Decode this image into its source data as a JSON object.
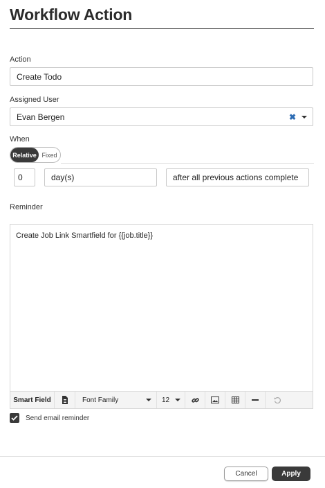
{
  "header": {
    "title": "Workflow Action"
  },
  "action": {
    "label": "Action",
    "value": "Create Todo"
  },
  "assigned_user": {
    "label": "Assigned User",
    "value": "Evan Bergen",
    "clear_glyph": "✖"
  },
  "when": {
    "label": "When",
    "toggle": {
      "relative": "Relative",
      "fixed": "Fixed",
      "selected": "Relative"
    },
    "amount": "0",
    "unit": "day(s)",
    "trigger": "after all previous actions complete"
  },
  "reminder": {
    "label": "Reminder",
    "content": "Create Job Link Smartfield for {{job.title}}",
    "toolbar": {
      "smart_field": "Smart Field",
      "font_family": "Font Family",
      "font_size": "12",
      "icons": [
        "document-icon",
        "link-icon",
        "image-icon",
        "table-icon",
        "horizontal-rule-icon",
        "undo-icon"
      ]
    }
  },
  "email_reminder": {
    "label": "Send email reminder",
    "checked": true
  },
  "footer": {
    "cancel_label": "Cancel",
    "apply_label": "Apply"
  },
  "colors": {
    "dark": "#3a3a3a",
    "clear_blue": "#2e6db4",
    "border": "#c8c8c8"
  }
}
